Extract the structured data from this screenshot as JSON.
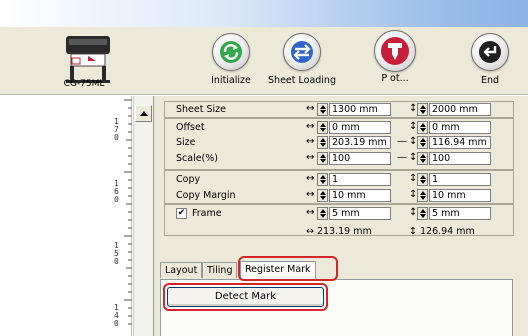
{
  "toolbar": {
    "device_name": "CG-75ML",
    "buttons": [
      {
        "label": "Initialize",
        "icon": "refresh-icon"
      },
      {
        "label": "Sheet Loading",
        "icon": "swap-arrows-icon"
      },
      {
        "label": "P ot...",
        "icon": "plotter-cutter-icon"
      },
      {
        "label": "End",
        "icon": "return-arrow-icon"
      }
    ]
  },
  "ruler": {
    "labels": [
      "1\n7\n0",
      "1\n6\n0",
      "1\n5\n0",
      "1\n4\n0"
    ]
  },
  "params": {
    "sheet_size": {
      "label": "Sheet Size",
      "w": "1300 mm",
      "h": "2000 mm"
    },
    "offset": {
      "label": "Offset",
      "w": "0 mm",
      "h": "0 mm"
    },
    "size": {
      "label": "Size",
      "w": "203.19 mm",
      "h": "116.94 mm"
    },
    "scale": {
      "label": "Scale(%)",
      "w": "100",
      "h": "100"
    },
    "copy": {
      "label": "Copy",
      "w": "1",
      "h": "1"
    },
    "copy_margin": {
      "label": "Copy Margin",
      "w": "10 mm",
      "h": "10 mm"
    },
    "frame": {
      "label": "Frame",
      "checked": "✔",
      "w": "5 mm",
      "h": "5 mm"
    },
    "total": {
      "w": "↔ 213.19 mm",
      "h": "↕ 126.94 mm"
    }
  },
  "symbols": {
    "horizontal": "↔",
    "vertical": "↕",
    "link": "—"
  },
  "tabs": [
    "Layout",
    "Tiling",
    "Register Mark"
  ],
  "detect_button": "Detect Mark",
  "colors": {
    "highlight": "#d4252a",
    "panel": "#ece9d8",
    "plotter_red": "#c81e3a"
  }
}
